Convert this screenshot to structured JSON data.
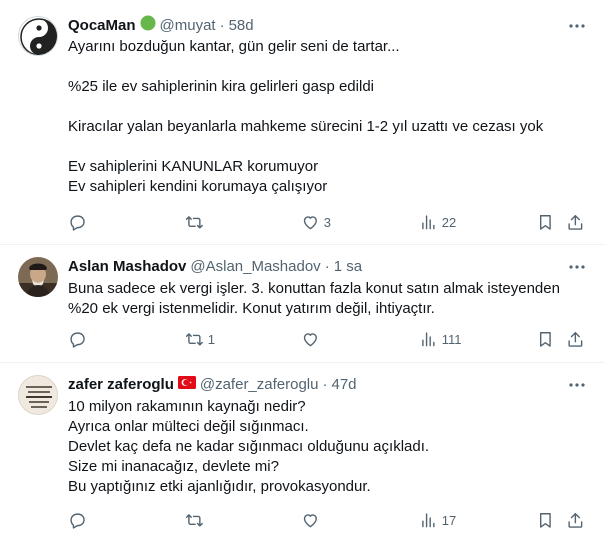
{
  "tweets": [
    {
      "name": "QocaMan",
      "handle": "@muyat",
      "time": "58d",
      "lines": [
        "Ayarını bozduğun kantar, gün gelir seni de tartar...",
        "",
        "%25 ile ev sahiplerinin kira gelirleri gasp edildi",
        "",
        "Kiracılar yalan beyanlarla mahkeme sürecini 1-2 yıl uzattı ve cezası yok",
        "",
        "Ev sahiplerini KANUNLAR korumuyor",
        "Ev sahipleri kendini korumaya çalışıyor"
      ],
      "reply_count": "",
      "retweet_count": "",
      "like_count": "3",
      "view_count": "22"
    },
    {
      "name": "Aslan Mashadov",
      "handle": "@Aslan_Mashadov",
      "time": "1 sa",
      "lines": [
        "Buna sadece ek vergi işler. 3. konuttan fazla konut satın almak isteyenden",
        "%20 ek vergi istenmelidir. Konut yatırım değil, ihtiyaçtır."
      ],
      "reply_count": "",
      "retweet_count": "1",
      "like_count": "",
      "view_count": "111"
    },
    {
      "name": "zafer zaferoglu",
      "handle": "@zafer_zaferoglu",
      "time": "47d",
      "lines": [
        "10 milyon rakamının kaynağı nedir?",
        "Ayrıca onlar mülteci değil sığınmacı.",
        "Devlet kaç defa ne kadar sığınmacı olduğunu açıkladı.",
        "Size mi inanacağız, devlete mi?",
        "Bu yaptığınız etki ajanlığıdır, provokasyondur."
      ],
      "reply_count": "",
      "retweet_count": "",
      "like_count": "",
      "view_count": "17"
    }
  ],
  "colors": {
    "text": "#0f1419",
    "secondary": "#536471",
    "border": "#eff3f4",
    "verified_green": "#66b84b",
    "flag_red": "#e30a17"
  },
  "icons": [
    "more-icon",
    "reply-icon",
    "retweet-icon",
    "like-icon",
    "views-icon",
    "bookmark-icon",
    "share-icon",
    "green-circle-badge-icon",
    "turkish-flag-icon"
  ]
}
